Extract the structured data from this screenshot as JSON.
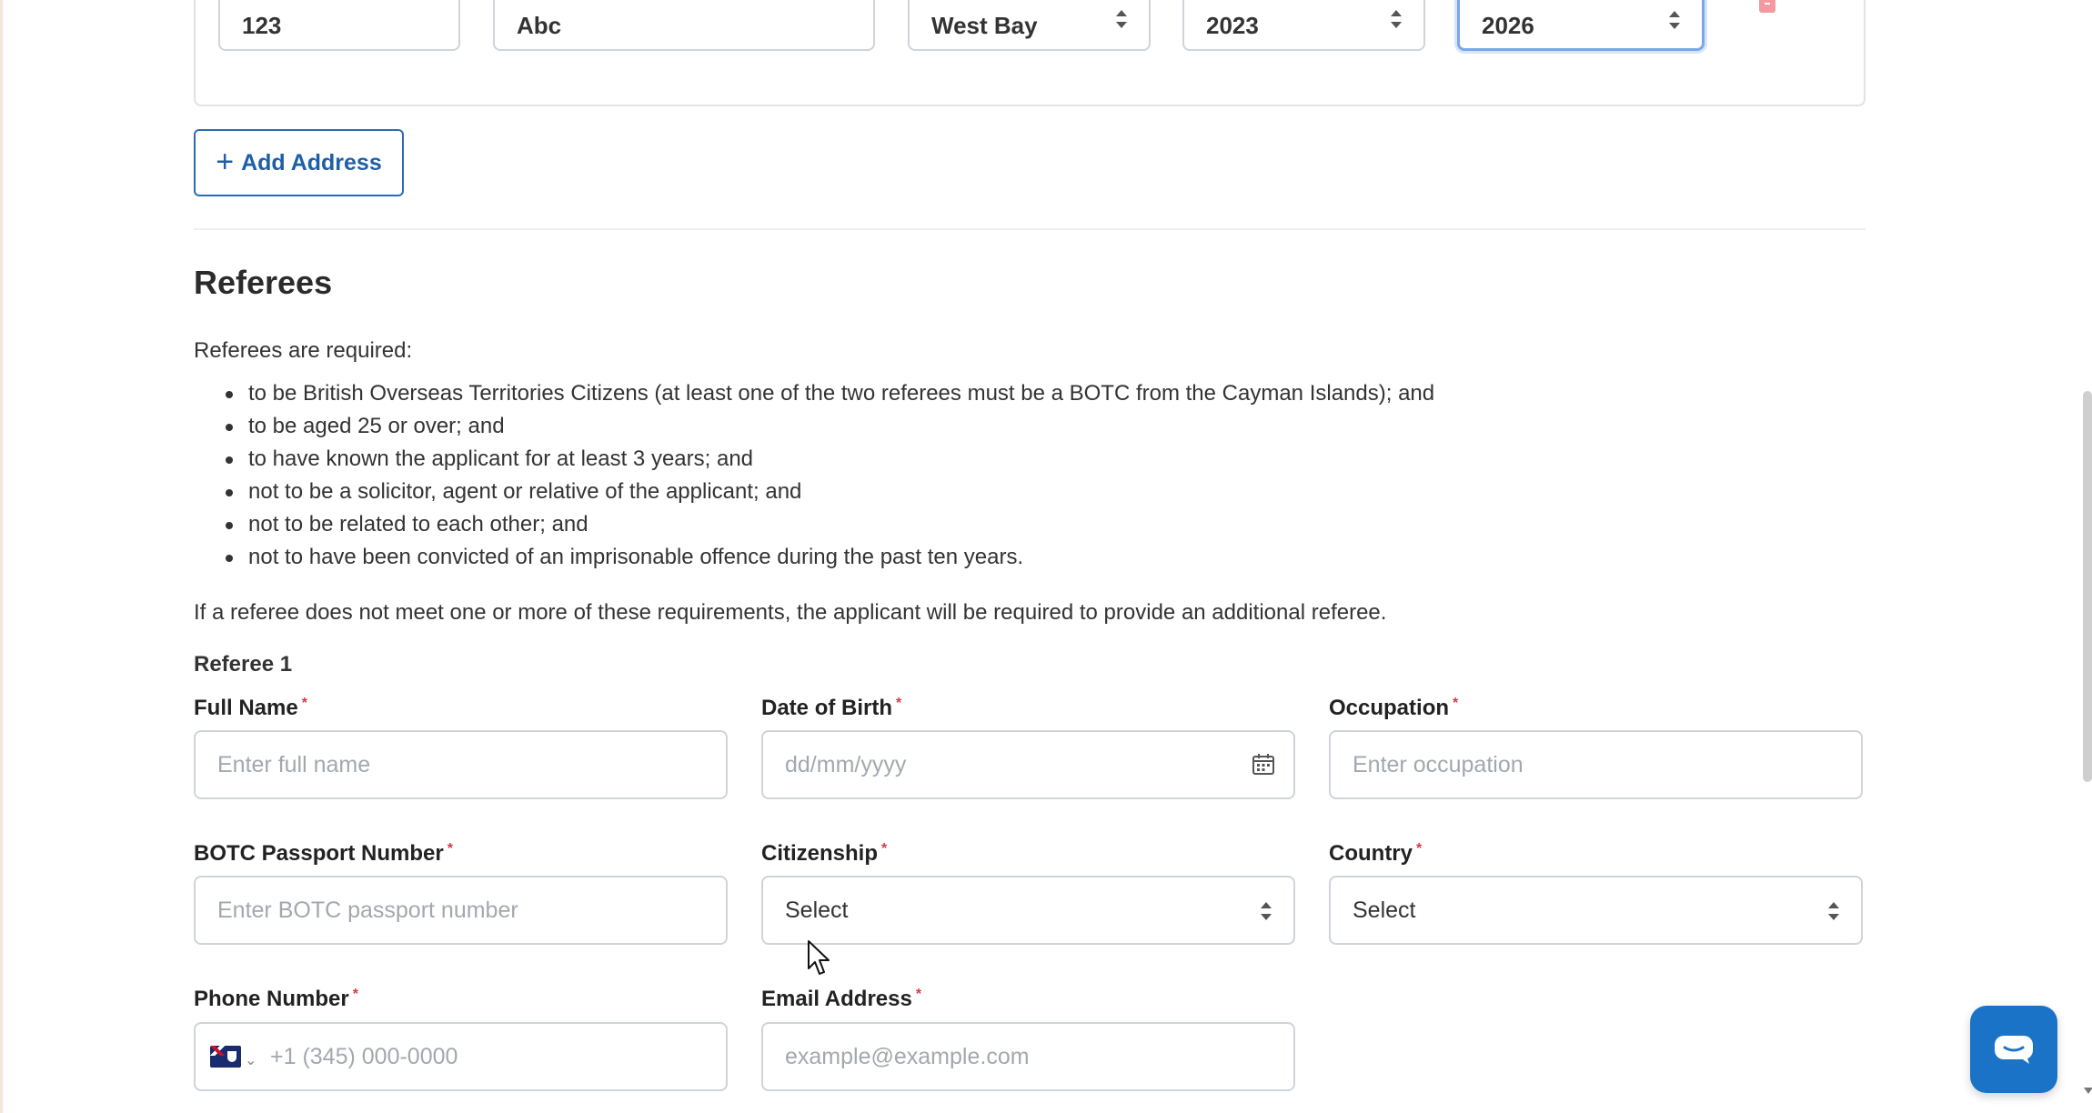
{
  "address_row": {
    "number": "123",
    "street": "Abc",
    "district": "West Bay",
    "from_year": "2023",
    "to_year": "2026"
  },
  "add_address_label": "Add Address",
  "referees": {
    "title": "Referees",
    "intro": "Referees are required:",
    "requirements": [
      "to be British Overseas Territories Citizens (at least one of the two referees must be a BOTC from the Cayman Islands); and",
      "to be aged 25 or over; and",
      "to have known the applicant for at least 3 years; and",
      "not to be a solicitor, agent or relative of the applicant; and",
      "not to be related to each other; and",
      "not to have been convicted of an imprisonable offence during the past ten years."
    ],
    "notice": "If a referee does not meet one or more of these requirements, the applicant will be required to provide an additional referee.",
    "referee1_label": "Referee 1"
  },
  "fields": {
    "full_name": {
      "label": "Full Name",
      "placeholder": "Enter full name"
    },
    "dob": {
      "label": "Date of Birth",
      "placeholder": "dd/mm/yyyy"
    },
    "occupation": {
      "label": "Occupation",
      "placeholder": "Enter occupation"
    },
    "passport": {
      "label": "BOTC Passport Number",
      "placeholder": "Enter BOTC passport number"
    },
    "citizenship": {
      "label": "Citizenship",
      "value": "Select"
    },
    "country": {
      "label": "Country",
      "value": "Select"
    },
    "phone": {
      "label": "Phone Number",
      "placeholder": "+1 (345) 000-0000"
    },
    "email": {
      "label": "Email Address",
      "placeholder": "example@example.com"
    }
  },
  "required_mark": "*",
  "colors": {
    "accent": "#1f5ea8",
    "required": "#d63a4a",
    "chat": "#1a73c7"
  }
}
